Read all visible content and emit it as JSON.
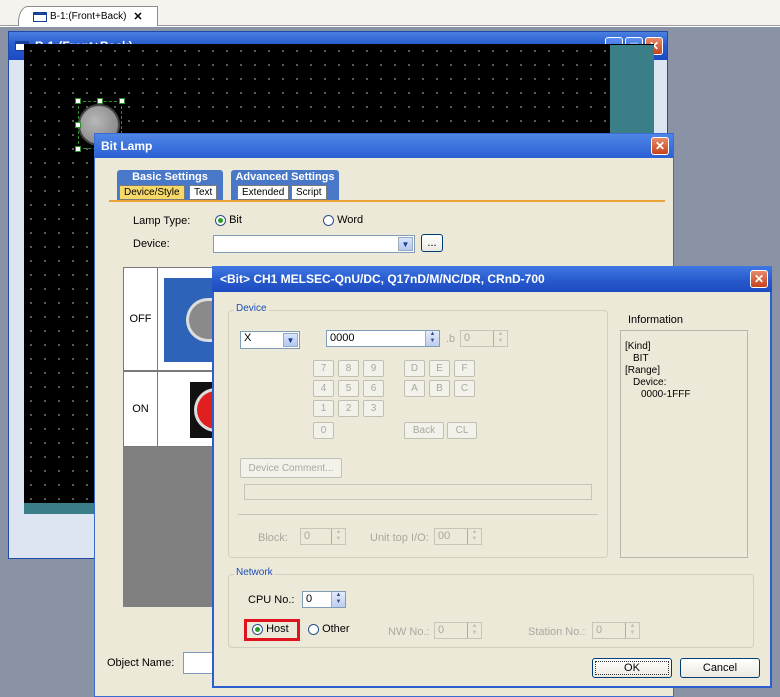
{
  "top_tab": {
    "label": "B-1:(Front+Back)",
    "close": "✕"
  },
  "screen_window": {
    "title": "B-1:(Front+Back)"
  },
  "bitlamp_dialog": {
    "title": "Bit Lamp",
    "tab_groups": [
      {
        "label": "Basic Settings",
        "subtabs": [
          "Device/Style",
          "Text"
        ]
      },
      {
        "label": "Advanced Settings",
        "subtabs": [
          "Extended",
          "Script"
        ]
      }
    ],
    "lamp_type_label": "Lamp Type:",
    "lamp_type_options": [
      "Bit",
      "Word"
    ],
    "lamp_type_selected": "Bit",
    "device_label": "Device:",
    "device_value": "",
    "browse_label": "...",
    "style_rows": [
      "OFF",
      "ON"
    ],
    "object_name_label": "Object Name:"
  },
  "device_dialog": {
    "title": "<Bit> CH1 MELSEC-QnU/DC, Q17nD/M/NC/DR, CRnD-700",
    "device_group": {
      "label": "Device",
      "device_type": "X",
      "device_number": "0000",
      "bit_label": ".b",
      "bit_value": "0",
      "keypad": [
        "7",
        "8",
        "9",
        "D",
        "E",
        "F",
        "4",
        "5",
        "6",
        "A",
        "B",
        "C",
        "1",
        "2",
        "3",
        "0"
      ],
      "back_label": "Back",
      "clear_label": "CL",
      "comment_button": "Device Comment...",
      "block_label": "Block:",
      "block_value": "0",
      "unit_label": "Unit top I/O:",
      "unit_value": "00"
    },
    "information": {
      "label": "Information",
      "lines": [
        "[Kind]",
        "BIT",
        "[Range]",
        "Device:",
        "0000-1FFF"
      ]
    },
    "network_group": {
      "label": "Network",
      "cpu_label": "CPU No.:",
      "cpu_value": "0",
      "host_label": "Host",
      "other_label": "Other",
      "selected": "Host",
      "nw_label": "NW No.:",
      "nw_value": "0",
      "station_label": "Station No.:",
      "station_value": "0"
    },
    "ok_label": "OK",
    "cancel_label": "Cancel"
  },
  "colors": {
    "highlight_box": "#e0141e",
    "title_blue": "#2a5fd0",
    "dialog_face": "#ece9d8"
  }
}
